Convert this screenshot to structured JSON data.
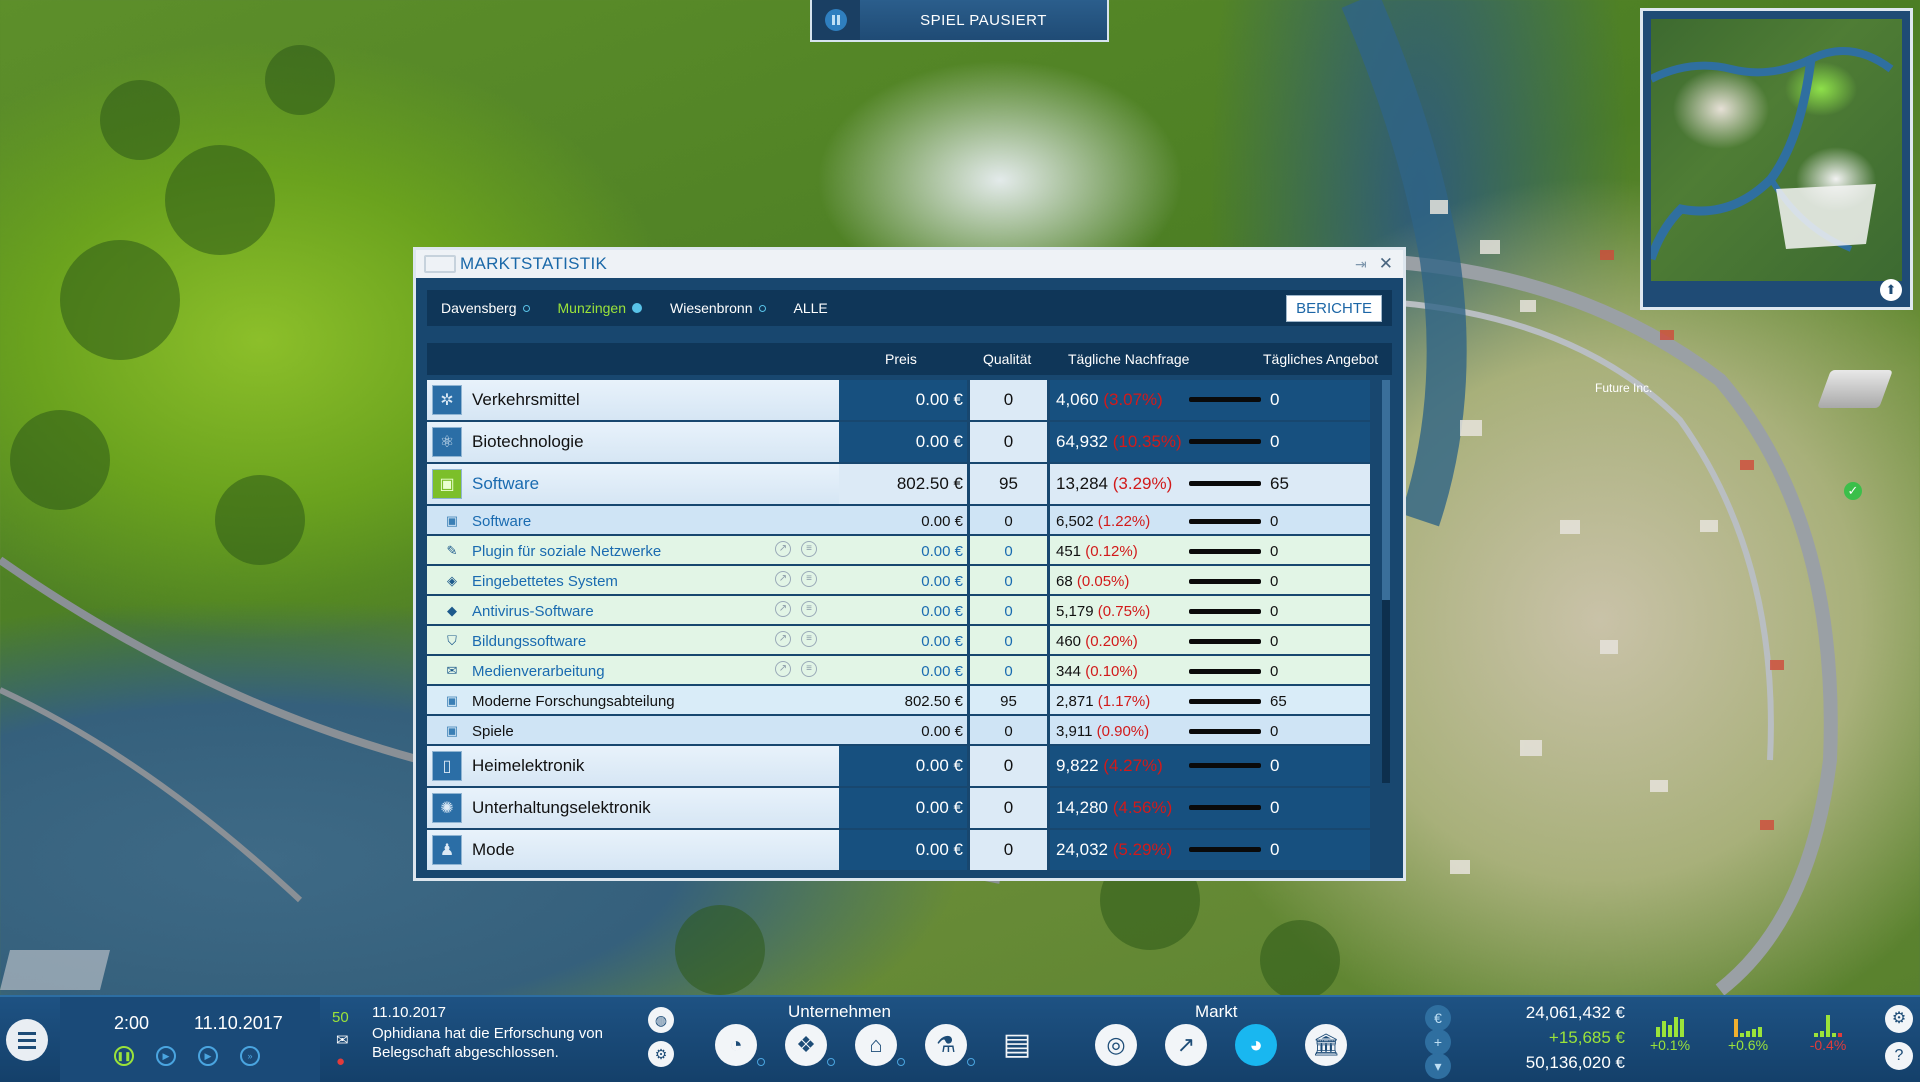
{
  "banner": {
    "title": "SPIEL PAUSIERT"
  },
  "window": {
    "title": "MARKTSTATISTIK",
    "tabs": [
      {
        "label": "Davensberg",
        "active": false
      },
      {
        "label": "Munzingen",
        "active": true
      },
      {
        "label": "Wiesenbronn",
        "active": false
      },
      {
        "label": "ALLE",
        "active": false
      }
    ],
    "reports_button": "BERICHTE",
    "columns": {
      "price": "Preis",
      "quality": "Qualität",
      "demand": "Tägliche Nachfrage",
      "supply": "Tägliches Angebot"
    },
    "rows": [
      {
        "type": "cat",
        "name": "Verkehrsmittel",
        "price": "0.00 €",
        "quality": "0",
        "demand": "4,060",
        "pct": "(3.07%)",
        "supply": "0"
      },
      {
        "type": "cat",
        "name": "Biotechnologie",
        "price": "0.00 €",
        "quality": "0",
        "demand": "64,932",
        "pct": "(10.35%)",
        "supply": "0"
      },
      {
        "type": "cat",
        "name": "Software",
        "price": "802.50 €",
        "quality": "95",
        "demand": "13,284",
        "pct": "(3.29%)",
        "supply": "65"
      },
      {
        "type": "sub",
        "name": "Software",
        "price": "0.00 €",
        "quality": "0",
        "demand": "6,502",
        "pct": "(1.22%)",
        "supply": "0"
      },
      {
        "type": "prod",
        "name": "Plugin für soziale Netzwerke",
        "price": "0.00 €",
        "quality": "0",
        "demand": "451",
        "pct": "(0.12%)",
        "supply": "0"
      },
      {
        "type": "prod",
        "name": "Eingebettetes System",
        "price": "0.00 €",
        "quality": "0",
        "demand": "68",
        "pct": "(0.05%)",
        "supply": "0"
      },
      {
        "type": "prod",
        "name": "Antivirus-Software",
        "price": "0.00 €",
        "quality": "0",
        "demand": "5,179",
        "pct": "(0.75%)",
        "supply": "0"
      },
      {
        "type": "prod",
        "name": "Bildungssoftware",
        "price": "0.00 €",
        "quality": "0",
        "demand": "460",
        "pct": "(0.20%)",
        "supply": "0"
      },
      {
        "type": "prod",
        "name": "Medienverarbeitung",
        "price": "0.00 €",
        "quality": "0",
        "demand": "344",
        "pct": "(0.10%)",
        "supply": "0"
      },
      {
        "type": "sub",
        "name": "Moderne Forschungsabteilung",
        "price": "802.50 €",
        "quality": "95",
        "demand": "2,871",
        "pct": "(1.17%)",
        "supply": "65"
      },
      {
        "type": "sub",
        "name": "Spiele",
        "price": "0.00 €",
        "quality": "0",
        "demand": "3,911",
        "pct": "(0.90%)",
        "supply": "0"
      },
      {
        "type": "cat",
        "name": "Heimelektronik",
        "price": "0.00 €",
        "quality": "0",
        "demand": "9,822",
        "pct": "(4.27%)",
        "supply": "0"
      },
      {
        "type": "cat",
        "name": "Unterhaltungselektronik",
        "price": "0.00 €",
        "quality": "0",
        "demand": "14,280",
        "pct": "(4.56%)",
        "supply": "0"
      },
      {
        "type": "cat",
        "name": "Mode",
        "price": "0.00 €",
        "quality": "0",
        "demand": "24,032",
        "pct": "(5.29%)",
        "supply": "0"
      }
    ]
  },
  "bottom": {
    "time": "2:00",
    "date": "11.10.2017",
    "message_count": "50",
    "news_date": "11.10.2017",
    "news_text": "Ophidiana hat die Erforschung von Belegschaft abgeschlossen.",
    "section_company": "Unternehmen",
    "section_market": "Markt",
    "money": "24,061,432 €",
    "income": "+15,685 €",
    "value": "50,136,020 €",
    "stats": [
      "+0.1%",
      "+0.6%",
      "-0.4%"
    ]
  },
  "map": {
    "label": "Future Inc."
  },
  "colors": {
    "accent_green": "#9be33a",
    "negative": "#d21a1a",
    "panel": "#18476f"
  }
}
